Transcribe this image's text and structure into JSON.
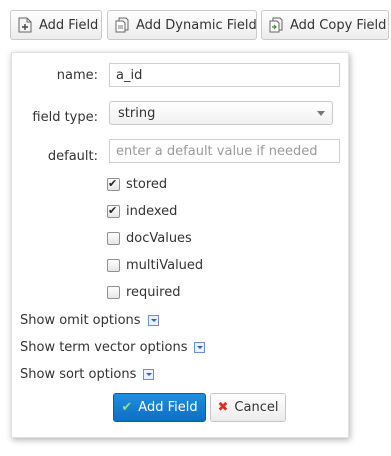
{
  "toolbar": {
    "add_field": "Add Field",
    "add_dynamic_field": "Add Dynamic Field",
    "add_copy_field": "Add Copy Field"
  },
  "form": {
    "name_label": "name:",
    "name_value": "a_id",
    "field_type_label": "field type:",
    "field_type_value": "string",
    "default_label": "default:",
    "default_placeholder": "enter a default value if needed",
    "checkboxes": [
      {
        "label": "stored",
        "checked": true
      },
      {
        "label": "indexed",
        "checked": true
      },
      {
        "label": "docValues",
        "checked": false
      },
      {
        "label": "multiValued",
        "checked": false
      },
      {
        "label": "required",
        "checked": false
      }
    ],
    "options": [
      "Show omit options",
      "Show term vector options",
      "Show sort options"
    ],
    "submit_label": "Add Field",
    "cancel_label": "Cancel"
  },
  "colors": {
    "primary": "#0d6ec4",
    "cancel_icon": "#d9302b",
    "check_icon": "#8fe07a"
  },
  "icons": {
    "add_field": "document-add-icon",
    "add_dynamic_field": "document-stack-icon",
    "add_copy_field": "document-copy-icon",
    "toggle": "expand-arrow-icon",
    "submit": "checkmark-icon",
    "cancel": "x-icon"
  }
}
